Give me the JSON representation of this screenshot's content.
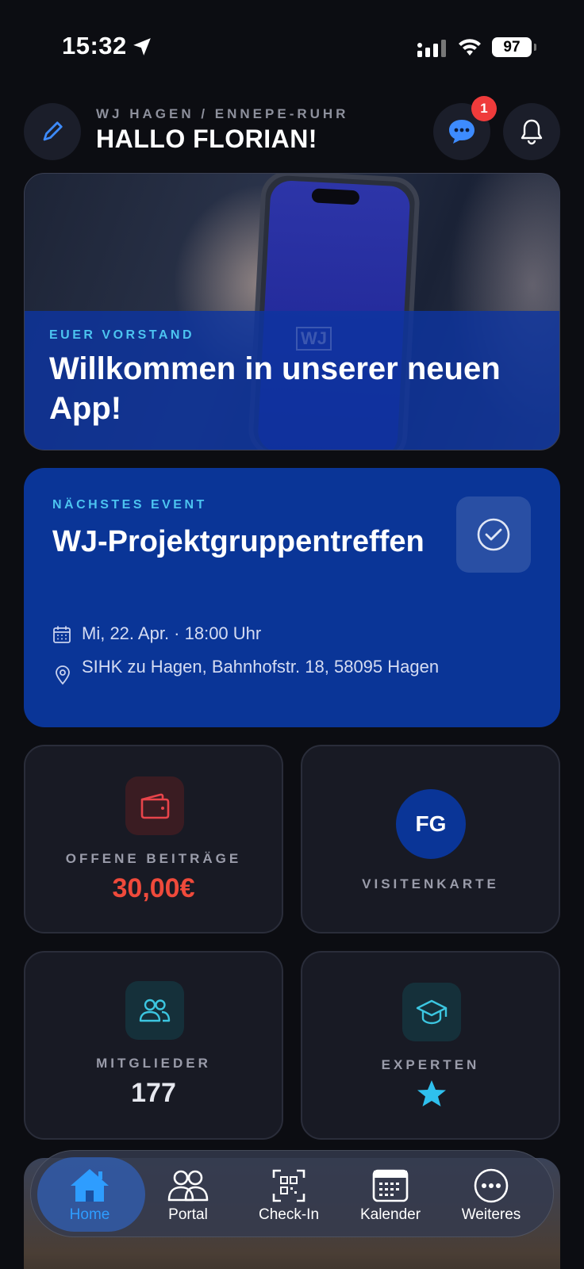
{
  "status_bar": {
    "time": "15:32",
    "battery": "97"
  },
  "header": {
    "org": "WJ HAGEN / ENNEPE-RUHR",
    "greeting": "HALLO FLORIAN!",
    "chat_badge": "1"
  },
  "welcome_card": {
    "tag": "EUER VORSTAND",
    "title": "Willkommen in unserer neuen App!",
    "watermark": "WJ"
  },
  "event_card": {
    "tag": "NÄCHSTES EVENT",
    "title": "WJ-Projektgruppentreffen",
    "date": "Mi, 22. Apr. · 18:00 Uhr",
    "location": "SIHK zu Hagen, Bahnhofstr. 18, 58095 Hagen"
  },
  "tiles": {
    "fees": {
      "label": "OFFENE BEITRÄGE",
      "value": "30,00€",
      "color": "#ef4a3b"
    },
    "card": {
      "label": "VISITENKARTE",
      "initials": "FG"
    },
    "members": {
      "label": "MITGLIEDER",
      "value": "177"
    },
    "experts": {
      "label": "EXPERTEN",
      "icon": "star-icon"
    }
  },
  "tabbar": {
    "items": [
      {
        "label": "Home",
        "icon": "home-icon",
        "active": true
      },
      {
        "label": "Portal",
        "icon": "people-icon",
        "active": false
      },
      {
        "label": "Check-In",
        "icon": "qr-scan-icon",
        "active": false
      },
      {
        "label": "Kalender",
        "icon": "calendar-icon",
        "active": false
      },
      {
        "label": "Weiteres",
        "icon": "more-icon",
        "active": false
      }
    ]
  },
  "colors": {
    "accent_blue": "#0a3597",
    "cyan": "#4cc4f0",
    "tab_active": "#2e9dff"
  }
}
